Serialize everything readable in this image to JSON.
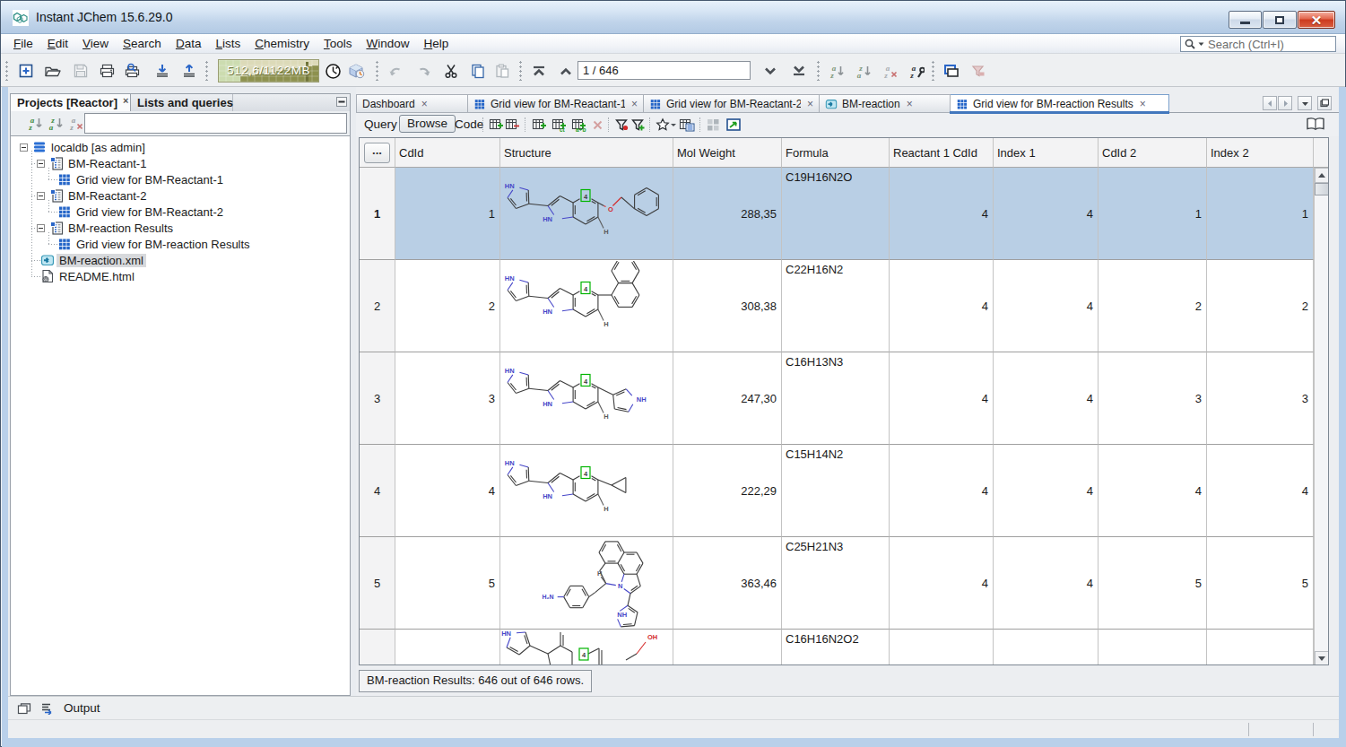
{
  "window": {
    "title": "Instant JChem 15.6.29.0"
  },
  "colors": {
    "selection": "#b9cfe5",
    "tab_accent": "#3f6fba",
    "titlebar": "#bdd4ec",
    "memory_gauge": "#8f9454"
  },
  "menu": {
    "items": [
      {
        "m": "F",
        "rest": "ile"
      },
      {
        "m": "E",
        "rest": "dit"
      },
      {
        "m": "V",
        "rest": "iew"
      },
      {
        "m": "S",
        "rest": "earch"
      },
      {
        "m": "D",
        "rest": "ata"
      },
      {
        "m": "L",
        "rest": "ists"
      },
      {
        "m": "C",
        "rest": "hemistry"
      },
      {
        "m": "T",
        "rest": "ools"
      },
      {
        "m": "W",
        "rest": "indow"
      },
      {
        "m": "H",
        "rest": "elp"
      }
    ]
  },
  "search": {
    "placeholder": "Search (Ctrl+I)"
  },
  "toolbar": {
    "memory": "512,6/1122MB",
    "record_indicator": "1 / 646"
  },
  "left_panel": {
    "tabs": [
      {
        "label": "Projects [Reactor]"
      },
      {
        "label": "Lists and queries"
      }
    ],
    "filter_value": "",
    "tree": [
      {
        "label": "localdb [as admin]"
      },
      {
        "label": "BM-Reactant-1"
      },
      {
        "label": "Grid view for BM-Reactant-1"
      },
      {
        "label": "BM-Reactant-2"
      },
      {
        "label": "Grid view for BM-Reactant-2"
      },
      {
        "label": "BM-reaction Results"
      },
      {
        "label": "Grid view for BM-reaction Results"
      },
      {
        "label": "BM-reaction.xml"
      },
      {
        "label": "README.html"
      }
    ]
  },
  "main_tabs": [
    {
      "label": "Dashboard"
    },
    {
      "label": "Grid view for BM-Reactant-1"
    },
    {
      "label": "Grid view for BM-Reactant-2"
    },
    {
      "label": "BM-reaction"
    },
    {
      "label": "Grid view for BM-reaction Results"
    }
  ],
  "query_bar": {
    "query": "Query",
    "browse": "Browse",
    "code": "Code"
  },
  "grid": {
    "corner": "...",
    "columns": [
      "CdId",
      "Structure",
      "Mol Weight",
      "Formula",
      "Reactant 1 CdId",
      "Index 1",
      "CdId 2",
      "Index 2"
    ],
    "rows": [
      {
        "num": "1",
        "cdid": "1",
        "mw": "288,35",
        "formula": "C19H16N2O",
        "r1cdid": "4",
        "index1": "4",
        "cdid2": "1",
        "index2": "1",
        "mol_ref": "#mol-1"
      },
      {
        "num": "2",
        "cdid": "2",
        "mw": "308,38",
        "formula": "C22H16N2",
        "r1cdid": "4",
        "index1": "4",
        "cdid2": "2",
        "index2": "2",
        "mol_ref": "#mol-2"
      },
      {
        "num": "3",
        "cdid": "3",
        "mw": "247,30",
        "formula": "C16H13N3",
        "r1cdid": "4",
        "index1": "4",
        "cdid2": "3",
        "index2": "3",
        "mol_ref": "#mol-3"
      },
      {
        "num": "4",
        "cdid": "4",
        "mw": "222,29",
        "formula": "C15H14N2",
        "r1cdid": "4",
        "index1": "4",
        "cdid2": "4",
        "index2": "4",
        "mol_ref": "#mol-4"
      },
      {
        "num": "5",
        "cdid": "5",
        "mw": "363,46",
        "formula": "C25H21N3",
        "r1cdid": "4",
        "index1": "4",
        "cdid2": "5",
        "index2": "5",
        "mol_ref": "#mol-5"
      },
      {
        "num": "",
        "cdid": "",
        "mw": "",
        "formula": "C16H16N2O2",
        "r1cdid": "",
        "index1": "",
        "cdid2": "",
        "index2": "",
        "mol_ref": "#mol-6"
      }
    ]
  },
  "status": {
    "grid_status": "BM-reaction Results: 646 out of 646 rows.",
    "output_label": "Output"
  }
}
